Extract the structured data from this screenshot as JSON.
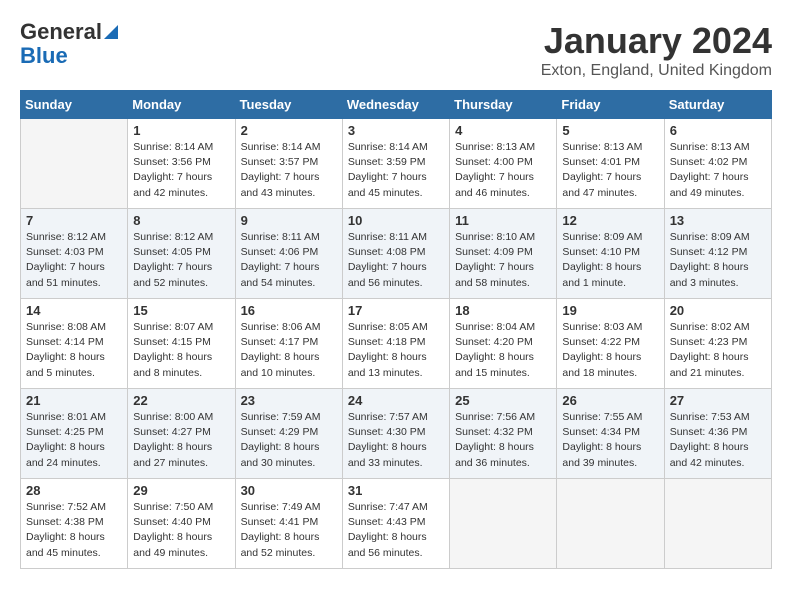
{
  "header": {
    "logo_line1": "General",
    "logo_line2": "Blue",
    "month": "January 2024",
    "location": "Exton, England, United Kingdom"
  },
  "weekdays": [
    "Sunday",
    "Monday",
    "Tuesday",
    "Wednesday",
    "Thursday",
    "Friday",
    "Saturday"
  ],
  "weeks": [
    [
      {
        "day": "",
        "empty": true
      },
      {
        "day": "1",
        "sunrise": "8:14 AM",
        "sunset": "3:56 PM",
        "daylight": "7 hours and 42 minutes."
      },
      {
        "day": "2",
        "sunrise": "8:14 AM",
        "sunset": "3:57 PM",
        "daylight": "7 hours and 43 minutes."
      },
      {
        "day": "3",
        "sunrise": "8:14 AM",
        "sunset": "3:59 PM",
        "daylight": "7 hours and 45 minutes."
      },
      {
        "day": "4",
        "sunrise": "8:13 AM",
        "sunset": "4:00 PM",
        "daylight": "7 hours and 46 minutes."
      },
      {
        "day": "5",
        "sunrise": "8:13 AM",
        "sunset": "4:01 PM",
        "daylight": "7 hours and 47 minutes."
      },
      {
        "day": "6",
        "sunrise": "8:13 AM",
        "sunset": "4:02 PM",
        "daylight": "7 hours and 49 minutes."
      }
    ],
    [
      {
        "day": "7",
        "sunrise": "8:12 AM",
        "sunset": "4:03 PM",
        "daylight": "7 hours and 51 minutes."
      },
      {
        "day": "8",
        "sunrise": "8:12 AM",
        "sunset": "4:05 PM",
        "daylight": "7 hours and 52 minutes."
      },
      {
        "day": "9",
        "sunrise": "8:11 AM",
        "sunset": "4:06 PM",
        "daylight": "7 hours and 54 minutes."
      },
      {
        "day": "10",
        "sunrise": "8:11 AM",
        "sunset": "4:08 PM",
        "daylight": "7 hours and 56 minutes."
      },
      {
        "day": "11",
        "sunrise": "8:10 AM",
        "sunset": "4:09 PM",
        "daylight": "7 hours and 58 minutes."
      },
      {
        "day": "12",
        "sunrise": "8:09 AM",
        "sunset": "4:10 PM",
        "daylight": "8 hours and 1 minute."
      },
      {
        "day": "13",
        "sunrise": "8:09 AM",
        "sunset": "4:12 PM",
        "daylight": "8 hours and 3 minutes."
      }
    ],
    [
      {
        "day": "14",
        "sunrise": "8:08 AM",
        "sunset": "4:14 PM",
        "daylight": "8 hours and 5 minutes."
      },
      {
        "day": "15",
        "sunrise": "8:07 AM",
        "sunset": "4:15 PM",
        "daylight": "8 hours and 8 minutes."
      },
      {
        "day": "16",
        "sunrise": "8:06 AM",
        "sunset": "4:17 PM",
        "daylight": "8 hours and 10 minutes."
      },
      {
        "day": "17",
        "sunrise": "8:05 AM",
        "sunset": "4:18 PM",
        "daylight": "8 hours and 13 minutes."
      },
      {
        "day": "18",
        "sunrise": "8:04 AM",
        "sunset": "4:20 PM",
        "daylight": "8 hours and 15 minutes."
      },
      {
        "day": "19",
        "sunrise": "8:03 AM",
        "sunset": "4:22 PM",
        "daylight": "8 hours and 18 minutes."
      },
      {
        "day": "20",
        "sunrise": "8:02 AM",
        "sunset": "4:23 PM",
        "daylight": "8 hours and 21 minutes."
      }
    ],
    [
      {
        "day": "21",
        "sunrise": "8:01 AM",
        "sunset": "4:25 PM",
        "daylight": "8 hours and 24 minutes."
      },
      {
        "day": "22",
        "sunrise": "8:00 AM",
        "sunset": "4:27 PM",
        "daylight": "8 hours and 27 minutes."
      },
      {
        "day": "23",
        "sunrise": "7:59 AM",
        "sunset": "4:29 PM",
        "daylight": "8 hours and 30 minutes."
      },
      {
        "day": "24",
        "sunrise": "7:57 AM",
        "sunset": "4:30 PM",
        "daylight": "8 hours and 33 minutes."
      },
      {
        "day": "25",
        "sunrise": "7:56 AM",
        "sunset": "4:32 PM",
        "daylight": "8 hours and 36 minutes."
      },
      {
        "day": "26",
        "sunrise": "7:55 AM",
        "sunset": "4:34 PM",
        "daylight": "8 hours and 39 minutes."
      },
      {
        "day": "27",
        "sunrise": "7:53 AM",
        "sunset": "4:36 PM",
        "daylight": "8 hours and 42 minutes."
      }
    ],
    [
      {
        "day": "28",
        "sunrise": "7:52 AM",
        "sunset": "4:38 PM",
        "daylight": "8 hours and 45 minutes."
      },
      {
        "day": "29",
        "sunrise": "7:50 AM",
        "sunset": "4:40 PM",
        "daylight": "8 hours and 49 minutes."
      },
      {
        "day": "30",
        "sunrise": "7:49 AM",
        "sunset": "4:41 PM",
        "daylight": "8 hours and 52 minutes."
      },
      {
        "day": "31",
        "sunrise": "7:47 AM",
        "sunset": "4:43 PM",
        "daylight": "8 hours and 56 minutes."
      },
      {
        "day": "",
        "empty": true
      },
      {
        "day": "",
        "empty": true
      },
      {
        "day": "",
        "empty": true
      }
    ]
  ]
}
